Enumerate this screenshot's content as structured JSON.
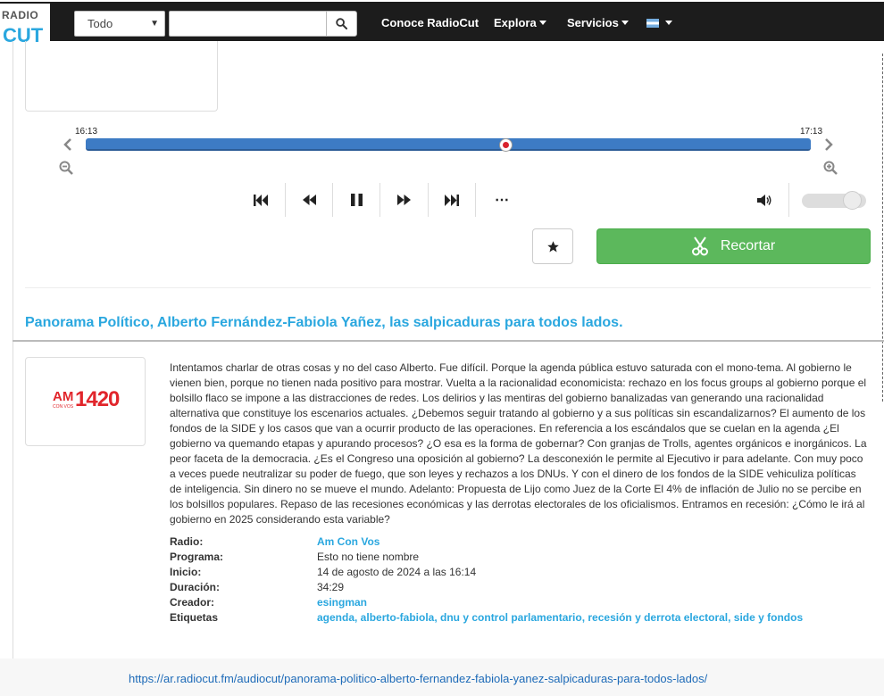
{
  "logo": {
    "line1": "RADIO",
    "line2": "CUT"
  },
  "nav": {
    "search_scope": "Todo",
    "search_placeholder": "",
    "links": [
      "Conoce RadioCut",
      "Explora",
      "Servicios"
    ]
  },
  "player": {
    "start_time": "16:13",
    "end_time": "17:13",
    "position_fraction": 0.58,
    "volume_fraction": 0.9,
    "more_label": "⋯",
    "cut_label": "Recortar"
  },
  "clip": {
    "title": "Panorama Político, Alberto Fernández-Fabiola Yañez, las salpicaduras para todos lados.",
    "radio_logo": {
      "am": "AM",
      "con_vos": "CON VOS",
      "number": "1420"
    },
    "description": "Intentamos charlar de otras cosas y no del caso Alberto. Fue difícil. Porque la agenda pública estuvo saturada con el mono-tema. Al gobierno le vienen bien, porque no tienen nada positivo para mostrar. Vuelta a la racionalidad economicista: rechazo en los focus groups al gobierno porque el bolsillo flaco se impone a las distracciones de redes. Los delirios y las mentiras del gobierno banalizadas van generando una racionalidad alternativa que constituye los escenarios actuales. ¿Debemos seguir tratando al gobierno y a sus políticas sin escandalizarnos? El aumento de los fondos de la SIDE y los casos que van a ocurrir producto de las operaciones. En referencia a los escándalos que se cuelan en la agenda ¿El gobierno va quemando etapas y apurando procesos? ¿O esa es la forma de gobernar? Con granjas de Trolls, agentes orgánicos e inorgánicos. La peor faceta de la democracia. ¿Es el Congreso una oposición al gobierno? La desconexión le permite al Ejecutivo ir para adelante. Con muy poco a veces puede neutralizar su poder de fuego, que son leyes y rechazos a los DNUs. Y con el dinero de los fondos de la SIDE vehiculiza políticas de inteligencia. Sin dinero no se mueve el mundo. Adelanto: Propuesta de Lijo como Juez de la Corte El 4% de inflación de Julio no se percibe en los bolsillos populares. Repaso de las recesiones económicas y las derrotas electorales de los oficialismos. Entramos en recesión: ¿Cómo le irá al gobierno en 2025 considerando esta variable?",
    "meta": [
      {
        "label": "Radio:",
        "value": "Am Con Vos",
        "link": true
      },
      {
        "label": "Programa:",
        "value": "Esto no tiene nombre",
        "link": false
      },
      {
        "label": "Inicio:",
        "value": "14 de agosto de 2024 a las 16:14",
        "link": false
      },
      {
        "label": "Duración:",
        "value": "34:29",
        "link": false
      },
      {
        "label": "Creador:",
        "value": "esingman",
        "link": true
      },
      {
        "label": "Etiquetas",
        "value": "agenda, alberto-fabiola, dnu y control parlamentario, recesión y derrota electoral, side y fondos",
        "link": true
      }
    ]
  },
  "footer": {
    "url": "https://ar.radiocut.fm/audiocut/panorama-politico-alberto-fernandez-fabiola-yanez-salpicaduras-para-todos-lados/"
  },
  "colors": {
    "nav_bg": "#1c1c1c",
    "accent": "#2aa7df",
    "progress": "#3d7bc4",
    "cut_button": "#5cb85c",
    "marker": "#d9232d"
  }
}
